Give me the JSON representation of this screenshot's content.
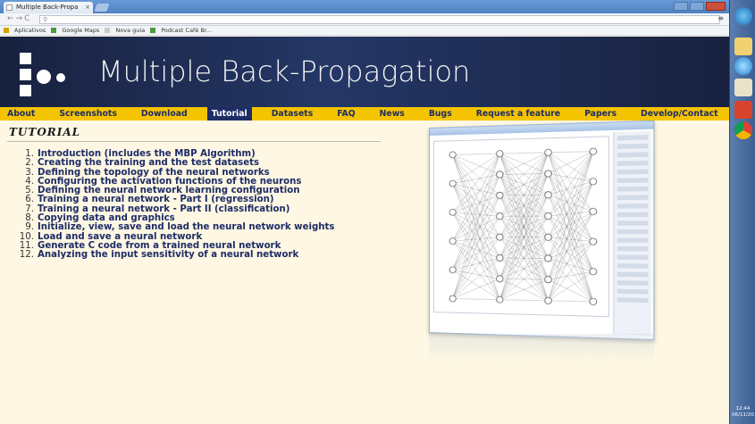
{
  "browser": {
    "tab_title": "Multiple Back-Propa",
    "tab_close": "×",
    "omnibox_text": "",
    "menu_icon": "hamburger-icon",
    "bookmarks": [
      {
        "label": "Aplicativos",
        "icon": "apps-icon",
        "color": "#d9a000"
      },
      {
        "label": "Google Maps",
        "icon": "maps-icon",
        "color": "#4a9c3c"
      },
      {
        "label": "Nova guia",
        "icon": "page-icon",
        "color": "#cccccc"
      },
      {
        "label": "Podcast Café Br...",
        "icon": "podcast-icon",
        "color": "#4a9c3c"
      }
    ]
  },
  "site": {
    "title": "Multiple Back-Propagation",
    "nav": [
      {
        "label": "About",
        "active": false
      },
      {
        "label": "Screenshots",
        "active": false
      },
      {
        "label": "Download",
        "active": false
      },
      {
        "label": "Tutorial",
        "active": true
      },
      {
        "label": "Datasets",
        "active": false
      },
      {
        "label": "FAQ",
        "active": false
      },
      {
        "label": "News",
        "active": false
      },
      {
        "label": "Bugs",
        "active": false
      },
      {
        "label": "Request a feature",
        "active": false
      },
      {
        "label": "Papers",
        "active": false
      },
      {
        "label": "Develop/Contact",
        "active": false
      }
    ],
    "heading": "Tutorial",
    "tutorial_items": [
      {
        "num": "1.",
        "text": "Introduction (includes the MBP Algorithm)"
      },
      {
        "num": "2.",
        "text": "Creating the training and the test datasets"
      },
      {
        "num": "3.",
        "text": "Defining the topology of the neural networks"
      },
      {
        "num": "4.",
        "text": "Configuring the activation functions of the neurons"
      },
      {
        "num": "5.",
        "text": "Defining the neural network learning configuration"
      },
      {
        "num": "6.",
        "text": "Training a neural network - Part I (regression)"
      },
      {
        "num": "7.",
        "text": "Training a neural network - Part II (classification)"
      },
      {
        "num": "8.",
        "text": "Copying data and graphics"
      },
      {
        "num": "9.",
        "text": "Initialize, view, save and load the neural network weights"
      },
      {
        "num": "10.",
        "text": "Load and save a neural network"
      },
      {
        "num": "11.",
        "text": "Generate C code from a trained neural network"
      },
      {
        "num": "12.",
        "text": "Analyzing the input sensitivity of a neural network"
      }
    ]
  },
  "colors": {
    "banner": "#1f2d55",
    "menubar": "#f5c400",
    "nav_text": "#1e2c66",
    "page_bg": "#fdf7e3"
  },
  "taskbar": {
    "clock_time": "12:44",
    "clock_date": "06/11/20"
  }
}
